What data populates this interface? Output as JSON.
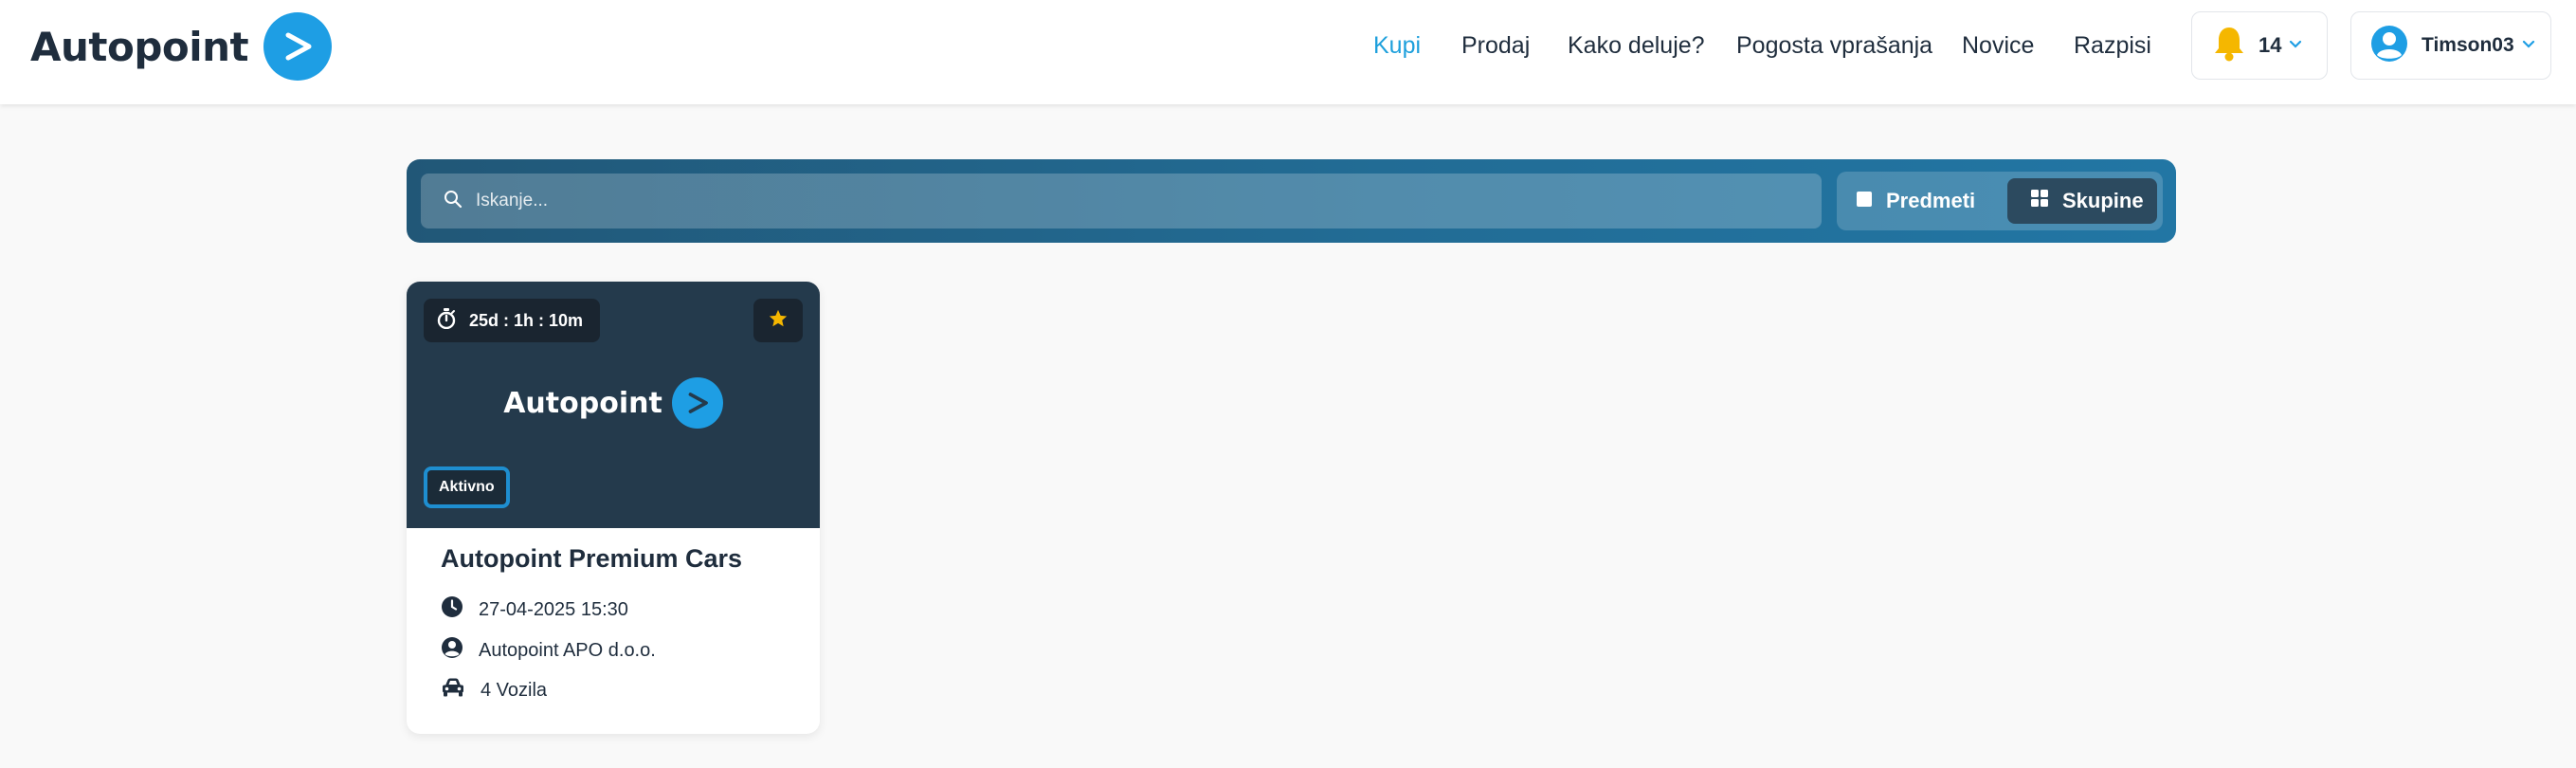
{
  "brand": {
    "name": "Autopoint",
    "accent": "#1e9ee4",
    "logo_arrow": ">"
  },
  "nav": {
    "items": [
      {
        "label": "Kupi",
        "active": true
      },
      {
        "label": "Prodaj",
        "active": false
      },
      {
        "label": "Kako deluje?",
        "active": false
      },
      {
        "label": "Pogosta vprašanja",
        "active": false
      },
      {
        "label": "Novice",
        "active": false
      },
      {
        "label": "Razpisi",
        "active": false
      }
    ],
    "active_color": "#1ea0dc"
  },
  "notifications": {
    "icon": "bell-icon",
    "count": "14",
    "icon_color": "#f5b700"
  },
  "user": {
    "icon": "user-circle-icon",
    "name": "Timson03",
    "icon_color": "#1e9ee4"
  },
  "search": {
    "placeholder": "Iskanje...",
    "value": "",
    "icon": "search-icon"
  },
  "view_toggle": {
    "items_label": "Predmeti",
    "groups_label": "Skupine",
    "selected": "Skupine"
  },
  "cards": [
    {
      "timer": "25d : 1h : 10m",
      "timer_icon": "stopwatch-icon",
      "favorite_icon": "star-icon",
      "favorite_color": "#f5b700",
      "logo_text": "Autopoint",
      "status": "Aktivno",
      "title": "Autopoint Premium Cars",
      "date": "27-04-2025 15:30",
      "seller": "Autopoint APO d.o.o.",
      "vehicles": "4 Vozila"
    }
  ]
}
